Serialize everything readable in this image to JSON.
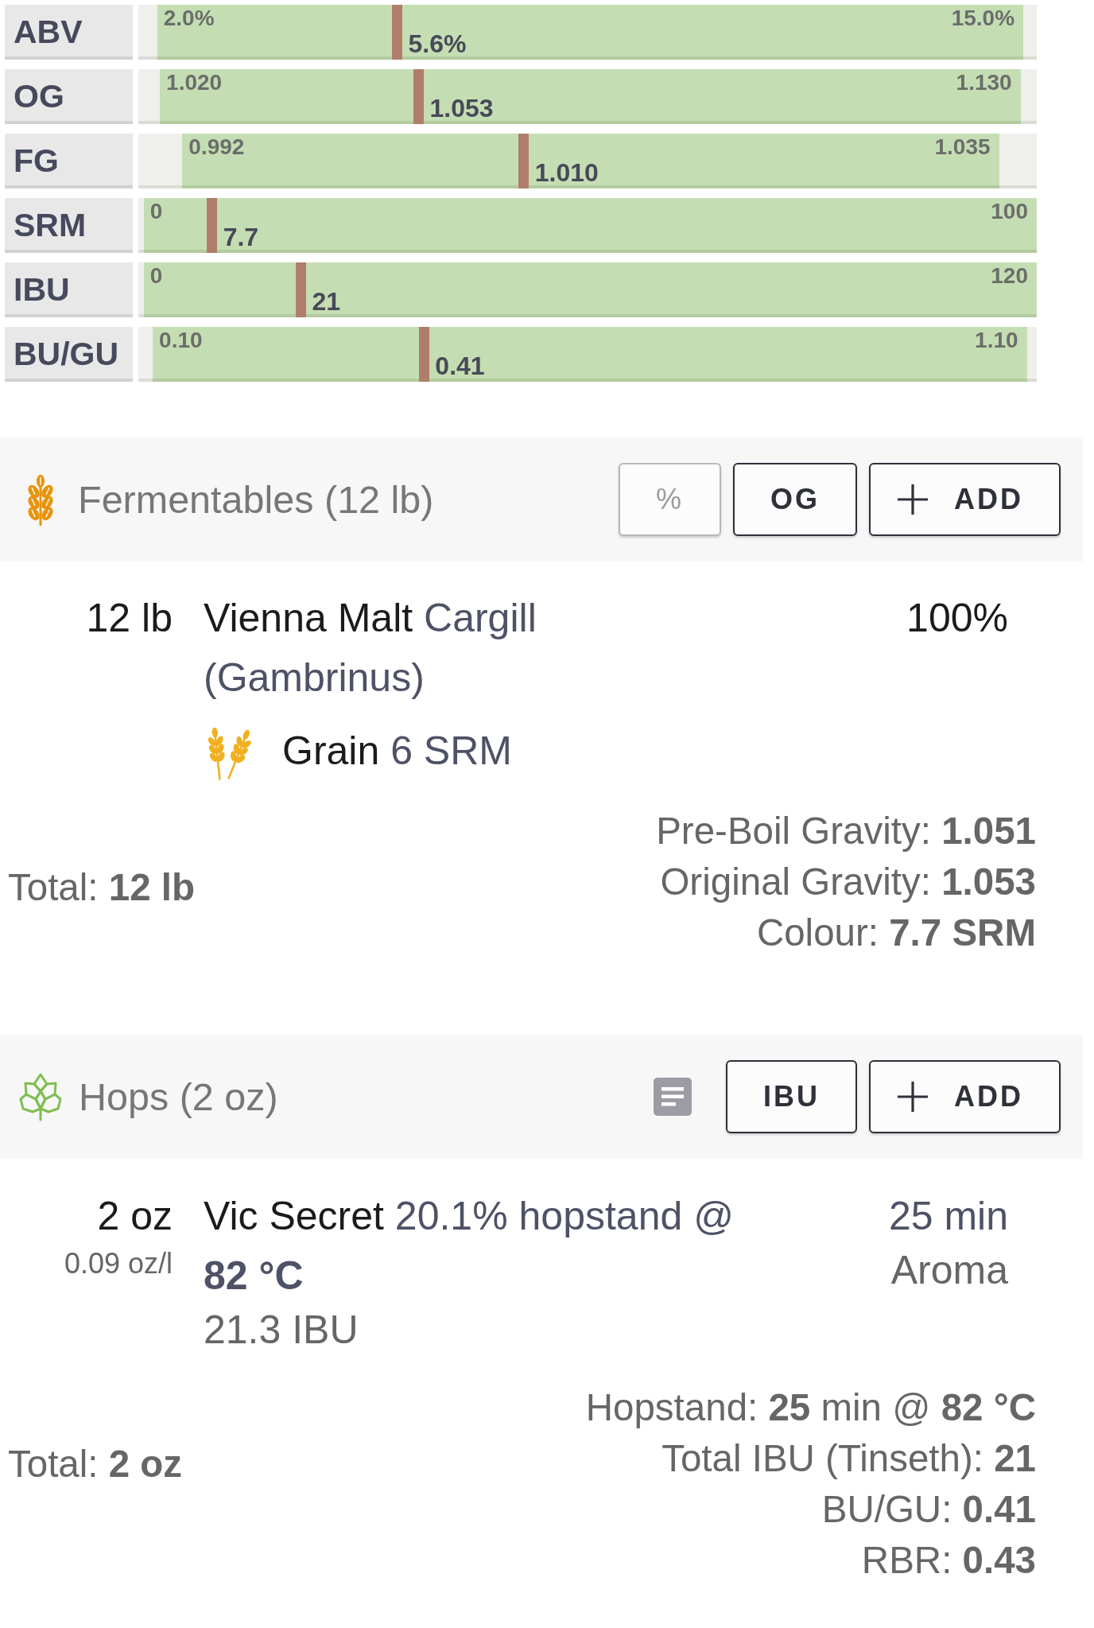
{
  "stats": [
    {
      "label": "ABV",
      "min": "2.0%",
      "max": "15.0%",
      "value": "5.6%",
      "range_start": {
        "level": 0.021
      },
      "range_end": {
        "level": 0.985
      },
      "marker": {
        "level": 0.288
      }
    },
    {
      "label": "OG",
      "min": "1.020",
      "max": "1.130",
      "value": "1.053",
      "range_start": {
        "level": 0.024
      },
      "range_end": {
        "level": 0.982
      },
      "marker": {
        "level": 0.312
      }
    },
    {
      "label": "FG",
      "min": "0.992",
      "max": "1.035",
      "value": "1.010",
      "range_start": {
        "level": 0.049
      },
      "range_end": {
        "level": 0.958
      },
      "marker": {
        "level": 0.429
      }
    },
    {
      "label": "SRM",
      "min": "0",
      "max": "100",
      "value": "7.7",
      "range_start": {
        "level": 0.006
      },
      "range_end": {
        "level": 1.0
      },
      "marker": {
        "level": 0.082
      }
    },
    {
      "label": "IBU",
      "min": "0",
      "max": "120",
      "value": "21",
      "range_start": {
        "level": 0.006
      },
      "range_end": {
        "level": 1.0
      },
      "marker": {
        "level": 0.181
      }
    },
    {
      "label": "BU/GU",
      "min": "0.10",
      "max": "1.10",
      "value": "0.41",
      "range_start": {
        "level": 0.016
      },
      "range_end": {
        "level": 0.989
      },
      "marker": {
        "level": 0.318
      }
    }
  ],
  "fermentables": {
    "title": "Fermentables (12 lb)",
    "tools": [
      {
        "kind": "toggle",
        "label": "%",
        "disabled": true
      },
      {
        "kind": "toggle",
        "label": "OG",
        "disabled": false
      },
      {
        "kind": "add",
        "label": "ADD"
      }
    ],
    "items": [
      {
        "amount": "12 lb",
        "name": "Vienna Malt",
        "supplier": "Cargill (Gambrinus)",
        "type": "Grain",
        "srm": "6 SRM",
        "percent": "100%"
      }
    ],
    "total": "Total: **12 lb**",
    "summary": [
      "Pre-Boil Gravity: **1.051**",
      "Original Gravity: **1.053**",
      "Colour: **7.7 SRM**"
    ]
  },
  "hops": {
    "title": "Hops (2 oz)",
    "tools": [
      {
        "kind": "notes"
      },
      {
        "kind": "toggle",
        "label": "IBU",
        "disabled": false
      },
      {
        "kind": "add",
        "label": "ADD"
      }
    ],
    "items": [
      {
        "amount": "2 oz",
        "rate": "0.09 oz/l",
        "name": "Vic Secret",
        "detail": "20.1% hopstand @ **82 °C**",
        "ibu": "21.3 IBU",
        "time": "25 min",
        "use": "Aroma"
      }
    ],
    "total": "Total: **2 oz**",
    "summary": [
      "Hopstand: **25** min @ **82 °C**",
      "Total IBU (Tinseth): **21**",
      "BU/GU: **0.41**",
      "RBR: **0.43**"
    ]
  }
}
